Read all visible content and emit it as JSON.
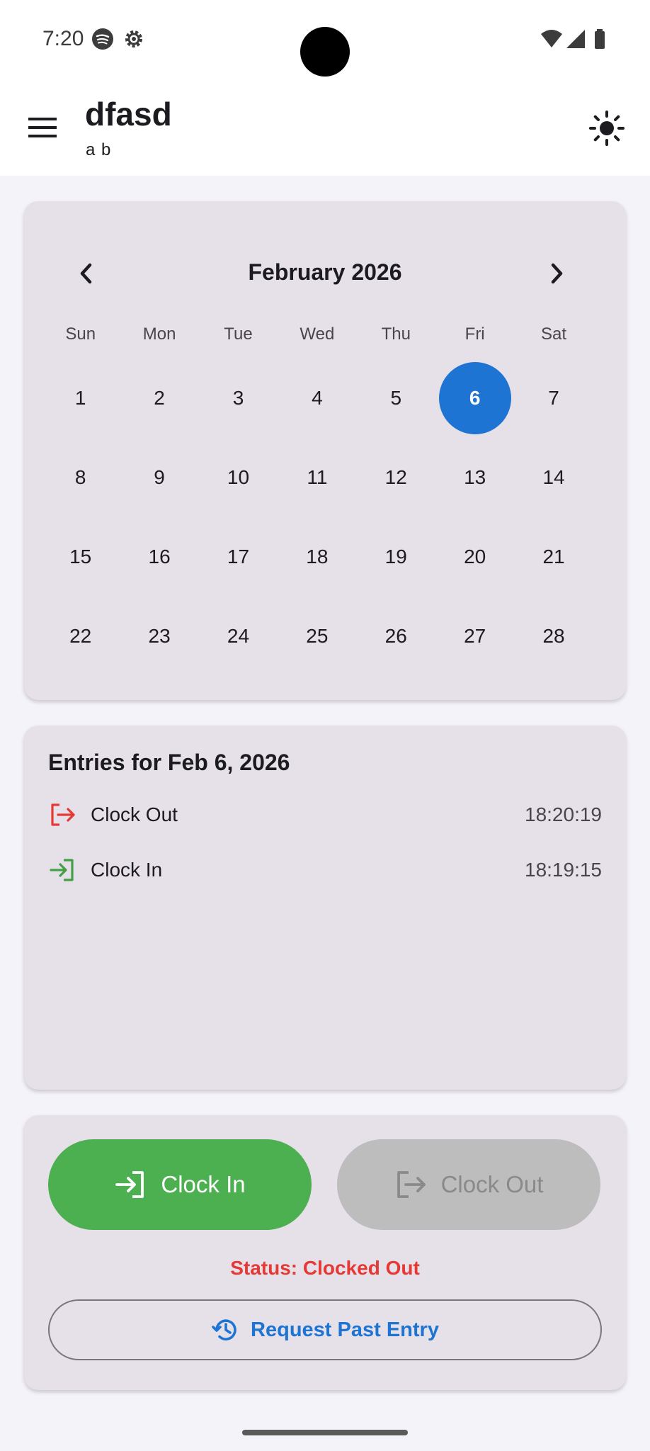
{
  "status_bar": {
    "time": "7:20",
    "icons": [
      "spotify-icon",
      "settings-icon",
      "wifi-icon",
      "signal-icon",
      "battery-icon"
    ]
  },
  "app_bar": {
    "title": "dfasd",
    "subtitle": "a b",
    "menu_icon": "hamburger-menu-icon",
    "theme_icon": "sun-icon"
  },
  "calendar": {
    "month_label": "February 2026",
    "weekdays": [
      "Sun",
      "Mon",
      "Tue",
      "Wed",
      "Thu",
      "Fri",
      "Sat"
    ],
    "weeks": [
      [
        "1",
        "2",
        "3",
        "4",
        "5",
        "6",
        "7"
      ],
      [
        "8",
        "9",
        "10",
        "11",
        "12",
        "13",
        "14"
      ],
      [
        "15",
        "16",
        "17",
        "18",
        "19",
        "20",
        "21"
      ],
      [
        "22",
        "23",
        "24",
        "25",
        "26",
        "27",
        "28"
      ]
    ],
    "selected_day": "6",
    "selected_color": "#1e74d2"
  },
  "entries": {
    "title": "Entries for Feb 6, 2026",
    "items": [
      {
        "label": "Clock Out",
        "time": "18:20:19",
        "icon": "logout-icon",
        "color": "#e53935"
      },
      {
        "label": "Clock In",
        "time": "18:19:15",
        "icon": "login-icon",
        "color": "#43a047"
      }
    ]
  },
  "actions": {
    "clock_in_label": "Clock In",
    "clock_out_label": "Clock Out",
    "status_text": "Status: Clocked Out",
    "request_label": "Request Past Entry",
    "clock_in_color": "#4caf50",
    "status_color": "#e53935",
    "accent_color": "#1e74d2"
  }
}
